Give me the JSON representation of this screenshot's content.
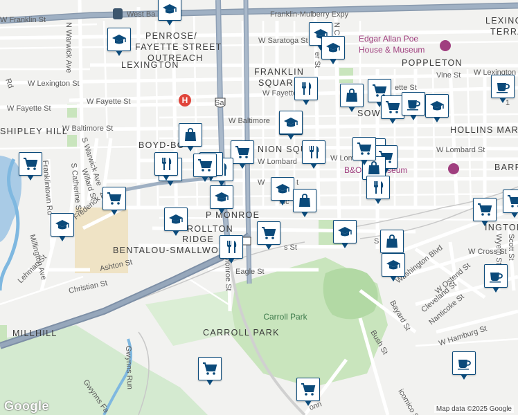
{
  "map": {
    "neighborhoods": [
      {
        "id": "penrose",
        "text": "PENROSE/"
      },
      {
        "id": "fayette-outreach",
        "text": "FAYETTE STREET"
      },
      {
        "id": "outreach",
        "text": "OUTREACH"
      },
      {
        "id": "lexington-nb",
        "text": "LEXINGTON"
      },
      {
        "id": "franklin",
        "text": "FRANKLIN"
      },
      {
        "id": "square",
        "text": "SQUARE"
      },
      {
        "id": "lexington-terr",
        "text": "LEXING"
      },
      {
        "id": "terr",
        "text": "TERRA"
      },
      {
        "id": "poppleton",
        "text": "POPPLETON"
      },
      {
        "id": "shipley",
        "text": "SHIPLEY HILL"
      },
      {
        "id": "boyd",
        "text": "BOYD-BO"
      },
      {
        "id": "union",
        "text": "NION SQU"
      },
      {
        "id": "hollins",
        "text": "HOLLINS MARKET"
      },
      {
        "id": "barre",
        "text": "BARR"
      },
      {
        "id": "pmonroe",
        "text": "P    MONROE"
      },
      {
        "id": "carrollton",
        "text": "ROLLTON"
      },
      {
        "id": "ridge",
        "text": "RIDGE"
      },
      {
        "id": "bentalou",
        "text": "BENTALOU-SMALLWO"
      },
      {
        "id": "millhill",
        "text": "MILLHILL"
      },
      {
        "id": "carroll-park-nb",
        "text": "CARROLL PARK"
      },
      {
        "id": "washington",
        "text": "INGTON"
      },
      {
        "id": "sowebo",
        "text": "SOWEB"
      }
    ],
    "streets": [
      {
        "id": "w-baltimore-top",
        "text": "West Ba"
      },
      {
        "id": "franklin-mulberry",
        "text": "Franklin-Mulberry Expy"
      },
      {
        "id": "franklintown",
        "text": "W Franklin St"
      },
      {
        "id": "warwick",
        "text": "N Warwick Ave"
      },
      {
        "id": "n-fredk",
        "text": "N Frederick"
      },
      {
        "id": "w-saratoga",
        "text": "W Saratoga St"
      },
      {
        "id": "vine",
        "text": "Vine St"
      },
      {
        "id": "w-lexington-st",
        "text": "W Lexington St"
      },
      {
        "id": "w-lexington-right",
        "text": "W Lexington"
      },
      {
        "id": "w-fayette",
        "text": "W Fayette St"
      },
      {
        "id": "w-fayette-mid",
        "text": "W Fayette"
      },
      {
        "id": "ette-st",
        "text": "ette St"
      },
      {
        "id": "w-fayette-left",
        "text": "W Fayette St"
      },
      {
        "id": "w-baltimore-left",
        "text": "W Baltimore St"
      },
      {
        "id": "w-baltimore-mid",
        "text": "W Baltimore"
      },
      {
        "id": "w-lombard-mid",
        "text": "W Lombard"
      },
      {
        "id": "w-lombard-2",
        "text": "W Lomb"
      },
      {
        "id": "w-lombard-right",
        "text": "W Lombard St"
      },
      {
        "id": "w-pratt",
        "text": "W"
      },
      {
        "id": "w-pratt-2",
        "text": "t"
      },
      {
        "id": "mcm",
        "text": "Mc"
      },
      {
        "id": "s-warwick",
        "text": "S Warwick Ave"
      },
      {
        "id": "willard",
        "text": "Willard St"
      },
      {
        "id": "s-catherine",
        "text": "S Catherine St"
      },
      {
        "id": "franklintown-rd",
        "text": "Franklintown Rd"
      },
      {
        "id": "frederick",
        "text": "Frederick Ave"
      },
      {
        "id": "millington",
        "text": "Millington Ave"
      },
      {
        "id": "lehman",
        "text": "Lehman St"
      },
      {
        "id": "ashton",
        "text": "Ashton St"
      },
      {
        "id": "christian",
        "text": "Christian St"
      },
      {
        "id": "eagle",
        "text": "Eagle St"
      },
      {
        "id": "s-monroe",
        "text": "Monroe St"
      },
      {
        "id": "ss-st",
        "text": "s St"
      },
      {
        "id": "washington-blvd",
        "text": "Washington Blvd"
      },
      {
        "id": "w-ostend",
        "text": "W Ostend St"
      },
      {
        "id": "w-cross",
        "text": "W Cross St"
      },
      {
        "id": "wyeth",
        "text": "Wyeth St"
      },
      {
        "id": "scott",
        "text": "Scott St"
      },
      {
        "id": "cleveland",
        "text": "Cleveland St"
      },
      {
        "id": "nanticoke",
        "text": "Nanticoke St"
      },
      {
        "id": "w-hamburg",
        "text": "W Hamburg St"
      },
      {
        "id": "bayard",
        "text": "Bayard St"
      },
      {
        "id": "bush",
        "text": "Bush St"
      },
      {
        "id": "s-st",
        "text": "S"
      },
      {
        "id": "gwynns-run",
        "text": "Gwynns Run"
      },
      {
        "id": "gwynns-fa",
        "text": "Gwynns Fa"
      },
      {
        "id": "icomico",
        "text": "icomico St"
      },
      {
        "id": "n-c",
        "text": "N C"
      },
      {
        "id": "er-st",
        "text": "er St"
      },
      {
        "id": "rd",
        "text": "Rd"
      },
      {
        "id": "sal",
        "text": "Sal"
      },
      {
        "id": "route-1",
        "text": "1"
      },
      {
        "id": "onn",
        "text": "onn"
      }
    ],
    "parks": [
      {
        "id": "carroll-park",
        "text": "Carroll Park"
      }
    ],
    "pois": [
      {
        "id": "poe-line1",
        "text": "Edgar Allan Poe"
      },
      {
        "id": "poe-line2",
        "text": "House & Museum"
      },
      {
        "id": "bo-museum",
        "text": "B&O      ad Museum"
      }
    ],
    "markers": [
      {
        "id": "m1",
        "type": "school",
        "icon": "graduation-cap-icon"
      },
      {
        "id": "m2",
        "type": "school",
        "icon": "graduation-cap-icon"
      },
      {
        "id": "m3",
        "type": "school",
        "icon": "graduation-cap-icon"
      },
      {
        "id": "m4",
        "type": "school",
        "icon": "graduation-cap-icon"
      },
      {
        "id": "m5",
        "type": "restaurant",
        "icon": "fork-knife-icon"
      },
      {
        "id": "m6",
        "type": "shopping",
        "icon": "shopping-bag-icon"
      },
      {
        "id": "m7",
        "type": "grocery",
        "icon": "shopping-cart-icon"
      },
      {
        "id": "m8",
        "type": "grocery",
        "icon": "shopping-cart-icon"
      },
      {
        "id": "m9",
        "type": "cafe",
        "icon": "coffee-cup-icon"
      },
      {
        "id": "m10",
        "type": "school",
        "icon": "graduation-cap-icon"
      },
      {
        "id": "m11",
        "type": "cafe",
        "icon": "coffee-cup-icon"
      },
      {
        "id": "m12",
        "type": "school",
        "icon": "graduation-cap-icon"
      },
      {
        "id": "m13",
        "type": "shopping",
        "icon": "shopping-bag-icon"
      },
      {
        "id": "m14",
        "type": "grocery",
        "icon": "shopping-cart-icon"
      },
      {
        "id": "m15",
        "type": "restaurant",
        "icon": "fork-knife-icon"
      },
      {
        "id": "m16",
        "type": "grocery",
        "icon": "shopping-cart-icon"
      },
      {
        "id": "m17",
        "type": "grocery",
        "icon": "shopping-cart-icon"
      },
      {
        "id": "m18",
        "type": "shopping",
        "icon": "shopping-bag-icon"
      },
      {
        "id": "m19",
        "type": "restaurant",
        "icon": "fork-knife-icon"
      },
      {
        "id": "m20",
        "type": "restaurant",
        "icon": "fork-knife-icon"
      },
      {
        "id": "m21",
        "type": "shopping",
        "icon": "shopping-bag-icon"
      },
      {
        "id": "m22",
        "type": "restaurant",
        "icon": "fork-knife-icon"
      },
      {
        "id": "m23",
        "type": "school",
        "icon": "graduation-cap-icon"
      },
      {
        "id": "m24",
        "type": "shopping",
        "icon": "shopping-bag-icon"
      },
      {
        "id": "m25",
        "type": "grocery",
        "icon": "shopping-cart-icon"
      },
      {
        "id": "m26",
        "type": "restaurant",
        "icon": "fork-knife-icon"
      },
      {
        "id": "m27",
        "type": "school",
        "icon": "graduation-cap-icon"
      },
      {
        "id": "m28",
        "type": "school",
        "icon": "graduation-cap-icon"
      },
      {
        "id": "m29",
        "type": "grocery",
        "icon": "shopping-cart-icon"
      },
      {
        "id": "m30",
        "type": "school",
        "icon": "graduation-cap-icon"
      },
      {
        "id": "m31",
        "type": "school",
        "icon": "graduation-cap-icon"
      },
      {
        "id": "m32",
        "type": "shopping",
        "icon": "shopping-bag-icon"
      },
      {
        "id": "m33",
        "type": "school",
        "icon": "graduation-cap-icon"
      },
      {
        "id": "m34",
        "type": "restaurant",
        "icon": "fork-knife-icon"
      },
      {
        "id": "m35",
        "type": "grocery",
        "icon": "shopping-cart-icon"
      },
      {
        "id": "m36",
        "type": "grocery",
        "icon": "shopping-cart-icon"
      },
      {
        "id": "m37",
        "type": "cafe",
        "icon": "coffee-cup-icon"
      },
      {
        "id": "m38",
        "type": "cafe",
        "icon": "coffee-cup-icon"
      },
      {
        "id": "m39",
        "type": "grocery",
        "icon": "shopping-cart-icon"
      },
      {
        "id": "m40",
        "type": "grocery",
        "icon": "shopping-cart-icon"
      },
      {
        "id": "m41",
        "type": "grocery",
        "icon": "shopping-cart-icon"
      },
      {
        "id": "m42",
        "type": "grocery",
        "icon": "shopping-cart-icon"
      },
      {
        "id": "m43",
        "type": "grocery",
        "icon": "shopping-cart-icon"
      },
      {
        "id": "m44",
        "type": "school",
        "icon": "graduation-cap-icon"
      }
    ],
    "hospital_letter": "H",
    "attribution": "Map data ©2025 Google",
    "logo": "Google",
    "colors": {
      "marker_border": "#0b4a7a",
      "highway": "#7d8fa6",
      "park": "#c4e3b8",
      "hospital": "#e0453b"
    }
  }
}
